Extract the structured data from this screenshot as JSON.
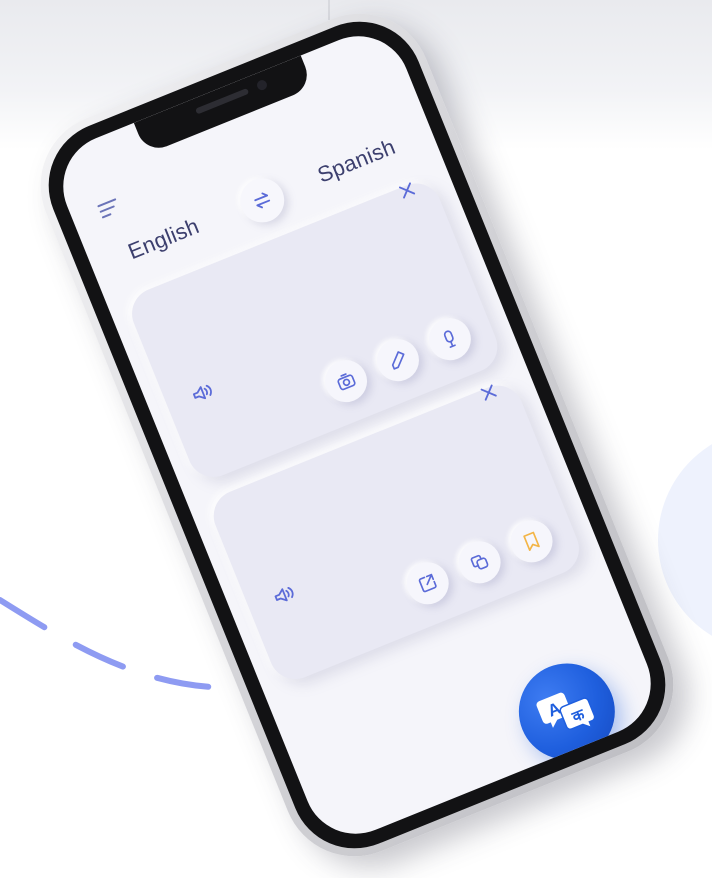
{
  "header": {
    "source_language": "English",
    "target_language": "Spanish"
  },
  "icons": {
    "menu": "menu-icon",
    "swap": "swap-icon",
    "close": "close-icon",
    "speaker": "speaker-icon",
    "camera": "camera-icon",
    "pencil": "pencil-icon",
    "microphone": "microphone-icon",
    "share": "share-icon",
    "copy": "copy-icon",
    "bookmark": "bookmark-icon",
    "translate": "translate-icon"
  },
  "fab": {
    "glyph_latin": "A",
    "glyph_devanagari": "क"
  },
  "colors": {
    "accent": "#1f5fde",
    "card_bg": "#e9e9f4",
    "screen_bg": "#f5f5fa",
    "icon": "#5b6bd8",
    "bookmark": "#f3b547",
    "label": "#3c3f6e"
  }
}
